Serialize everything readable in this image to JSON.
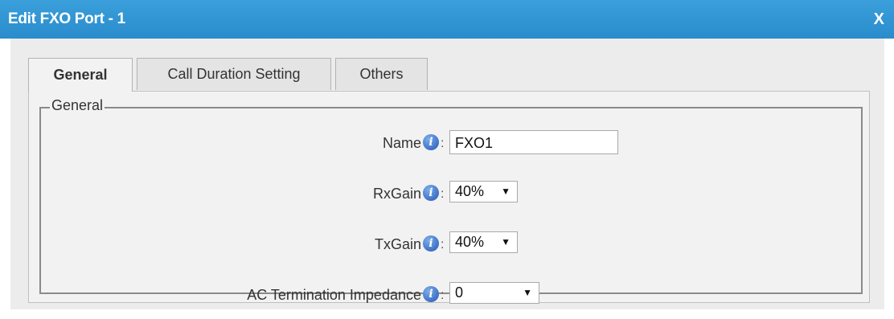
{
  "dialog": {
    "title": "Edit FXO Port - 1",
    "close_label": "X"
  },
  "tabs": [
    {
      "label": "General",
      "active": true
    },
    {
      "label": "Call Duration Setting",
      "active": false
    },
    {
      "label": "Others",
      "active": false
    }
  ],
  "general_section": {
    "legend": "General",
    "fields": {
      "name": {
        "label": "Name",
        "value": "FXO1"
      },
      "rx_gain": {
        "label": "RxGain",
        "value": "40%"
      },
      "tx_gain": {
        "label": "TxGain",
        "value": "40%"
      },
      "ac_impedance": {
        "label": "AC Termination Impedance",
        "value": "0"
      }
    },
    "info_icon_glyph": "i",
    "colon": ":"
  },
  "colors": {
    "titlebar": "#2a8ccc",
    "info_icon": "#2656b6"
  },
  "icons": {
    "info": "info-circle-icon",
    "dropdown": "triangle-down-icon"
  }
}
